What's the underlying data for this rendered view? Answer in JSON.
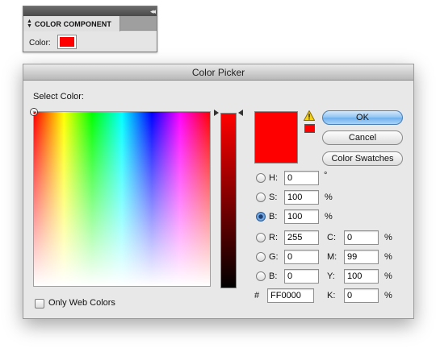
{
  "component_panel": {
    "tab_label": "COLOR COMPONENT",
    "color_label": "Color:",
    "swatch_color": "#ff0000",
    "collapse_glyph": "◂◂"
  },
  "dialog": {
    "title": "Color Picker",
    "select_label": "Select Color:",
    "current_color": "#ff0000",
    "buttons": {
      "ok": "OK",
      "cancel": "Cancel",
      "swatches": "Color Swatches"
    },
    "hsb": [
      {
        "label": "H:",
        "value": "0",
        "unit": "°",
        "selected": false
      },
      {
        "label": "S:",
        "value": "100",
        "unit": "%",
        "selected": false
      },
      {
        "label": "B:",
        "value": "100",
        "unit": "%",
        "selected": true
      }
    ],
    "rgb": [
      {
        "label": "R:",
        "value": "255"
      },
      {
        "label": "G:",
        "value": "0"
      },
      {
        "label": "B:",
        "value": "0"
      }
    ],
    "cmyk": [
      {
        "label": "C:",
        "value": "0",
        "unit": "%"
      },
      {
        "label": "M:",
        "value": "99",
        "unit": "%"
      },
      {
        "label": "Y:",
        "value": "100",
        "unit": "%"
      },
      {
        "label": "K:",
        "value": "0",
        "unit": "%"
      }
    ],
    "hex": {
      "label": "#",
      "value": "FF0000"
    },
    "only_web_colors": {
      "label": "Only Web Colors",
      "checked": false
    },
    "icons": [
      "warning-icon",
      "web-safe-swatch"
    ]
  }
}
